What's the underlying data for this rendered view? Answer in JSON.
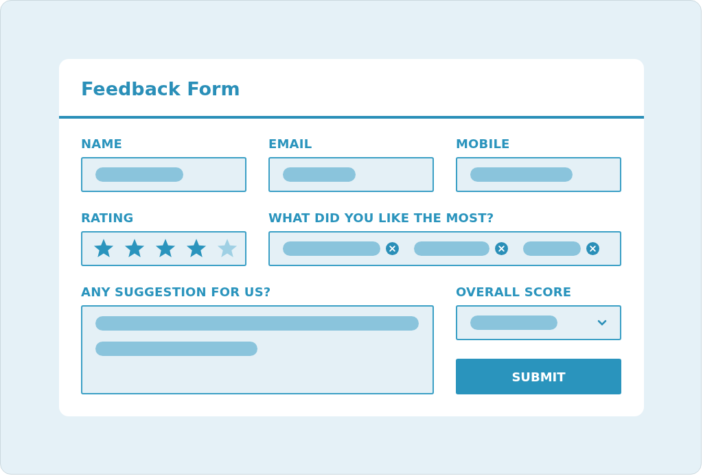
{
  "title": "Feedback Form",
  "fields": [
    {
      "label": "NAME",
      "kind": "text"
    },
    {
      "label": "EMAIL",
      "kind": "text"
    },
    {
      "label": "MOBILE",
      "kind": "text"
    },
    {
      "label": "RATING",
      "kind": "rating",
      "stars": 4
    },
    {
      "label": "WHAT DID YOU LIKE THE MOST?",
      "kind": "tags"
    },
    {
      "label": "ANY SUGGESTION FOR US?",
      "kind": "textarea"
    },
    {
      "label": "OVERALL SCORE",
      "kind": "select"
    }
  ],
  "submit": {
    "label": "SUBMIT"
  }
}
